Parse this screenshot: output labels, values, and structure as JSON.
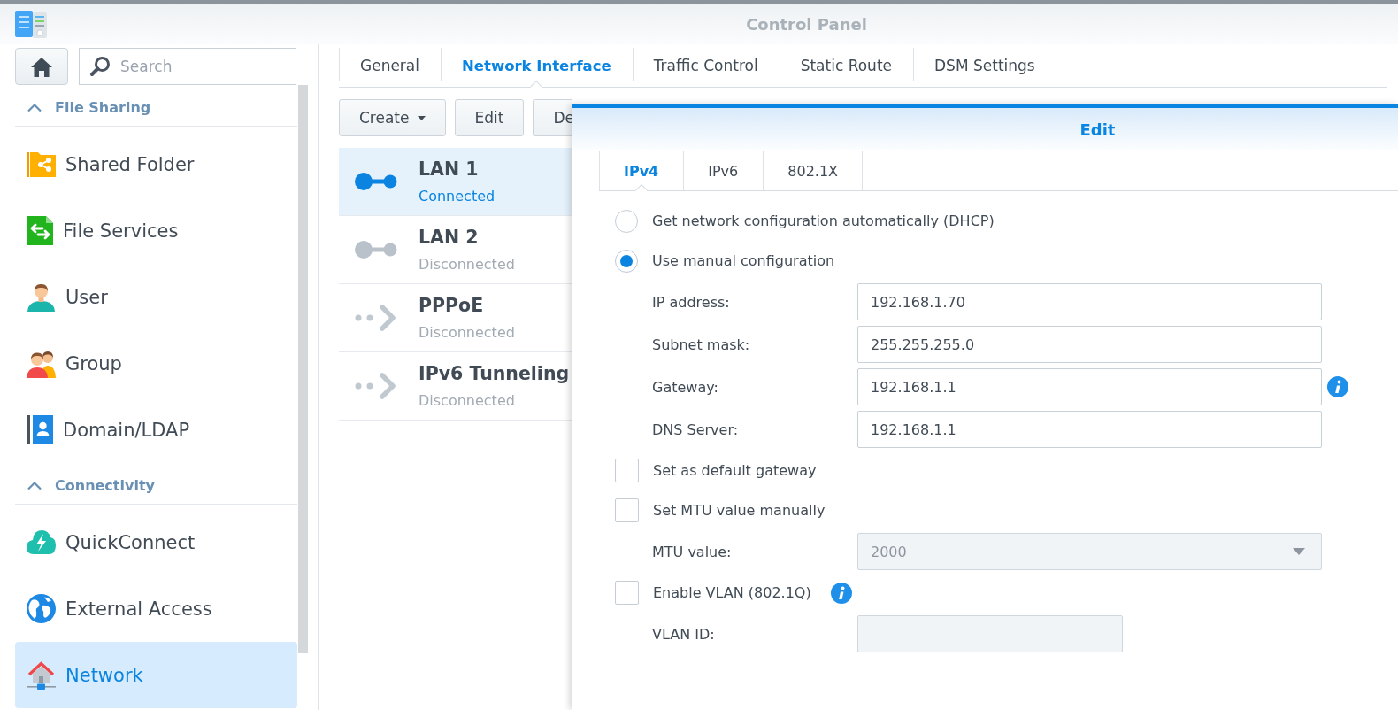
{
  "window": {
    "title": "Control Panel"
  },
  "sidebar": {
    "search": {
      "placeholder": "Search"
    },
    "sections": [
      {
        "title": "File Sharing",
        "expanded": true,
        "items": [
          {
            "label": "Shared Folder",
            "selected": false
          },
          {
            "label": "File Services",
            "selected": false
          },
          {
            "label": "User",
            "selected": false
          },
          {
            "label": "Group",
            "selected": false
          },
          {
            "label": "Domain/LDAP",
            "selected": false
          }
        ]
      },
      {
        "title": "Connectivity",
        "expanded": true,
        "items": [
          {
            "label": "QuickConnect",
            "selected": false
          },
          {
            "label": "External Access",
            "selected": false
          },
          {
            "label": "Network",
            "selected": true
          }
        ]
      }
    ]
  },
  "tabs": [
    {
      "label": "General",
      "selected": false
    },
    {
      "label": "Network Interface",
      "selected": true
    },
    {
      "label": "Traffic Control",
      "selected": false
    },
    {
      "label": "Static Route",
      "selected": false
    },
    {
      "label": "DSM Settings",
      "selected": false
    }
  ],
  "toolbar": [
    {
      "label": "Create",
      "kind": "dropdown"
    },
    {
      "label": "Edit",
      "kind": "button"
    },
    {
      "label": "De",
      "kind": "button"
    }
  ],
  "interfaces": [
    {
      "name": "LAN 1",
      "status": "Connected",
      "kind": "ethernet",
      "connected": true,
      "selected": true
    },
    {
      "name": "LAN 2",
      "status": "Disconnected",
      "kind": "ethernet",
      "connected": false,
      "selected": false
    },
    {
      "name": "PPPoE",
      "status": "Disconnected",
      "kind": "tunnel",
      "connected": false,
      "selected": false
    },
    {
      "name": "IPv6 Tunneling",
      "status": "Disconnected",
      "kind": "tunnel",
      "connected": false,
      "selected": false
    }
  ],
  "dialog": {
    "title": "Edit",
    "tabs": [
      {
        "label": "IPv4",
        "selected": true
      },
      {
        "label": "IPv6",
        "selected": false
      },
      {
        "label": "802.1X",
        "selected": false
      }
    ],
    "rows": [
      {
        "kind": "radio",
        "label": "Get network configuration automatically (DHCP)",
        "selected": false
      },
      {
        "kind": "radio",
        "label": "Use manual configuration",
        "selected": true
      },
      {
        "kind": "field",
        "label": "IP address:",
        "value": "192.168.1.70",
        "disabled": false
      },
      {
        "kind": "field",
        "label": "Subnet mask:",
        "value": "255.255.255.0",
        "disabled": false
      },
      {
        "kind": "field",
        "label": "Gateway:",
        "value": "192.168.1.1",
        "disabled": false,
        "info": true
      },
      {
        "kind": "field",
        "label": "DNS Server:",
        "value": "192.168.1.1",
        "disabled": false
      },
      {
        "kind": "checkbox",
        "label": "Set as default gateway",
        "checked": false
      },
      {
        "kind": "checkbox",
        "label": "Set MTU value manually",
        "checked": false
      },
      {
        "kind": "select",
        "label": "MTU value:",
        "value": "2000",
        "disabled": true
      },
      {
        "kind": "checkbox",
        "label": "Enable VLAN (802.1Q)",
        "checked": false,
        "info": true
      },
      {
        "kind": "shortfield",
        "label": "VLAN ID:",
        "disabled": true
      }
    ]
  }
}
